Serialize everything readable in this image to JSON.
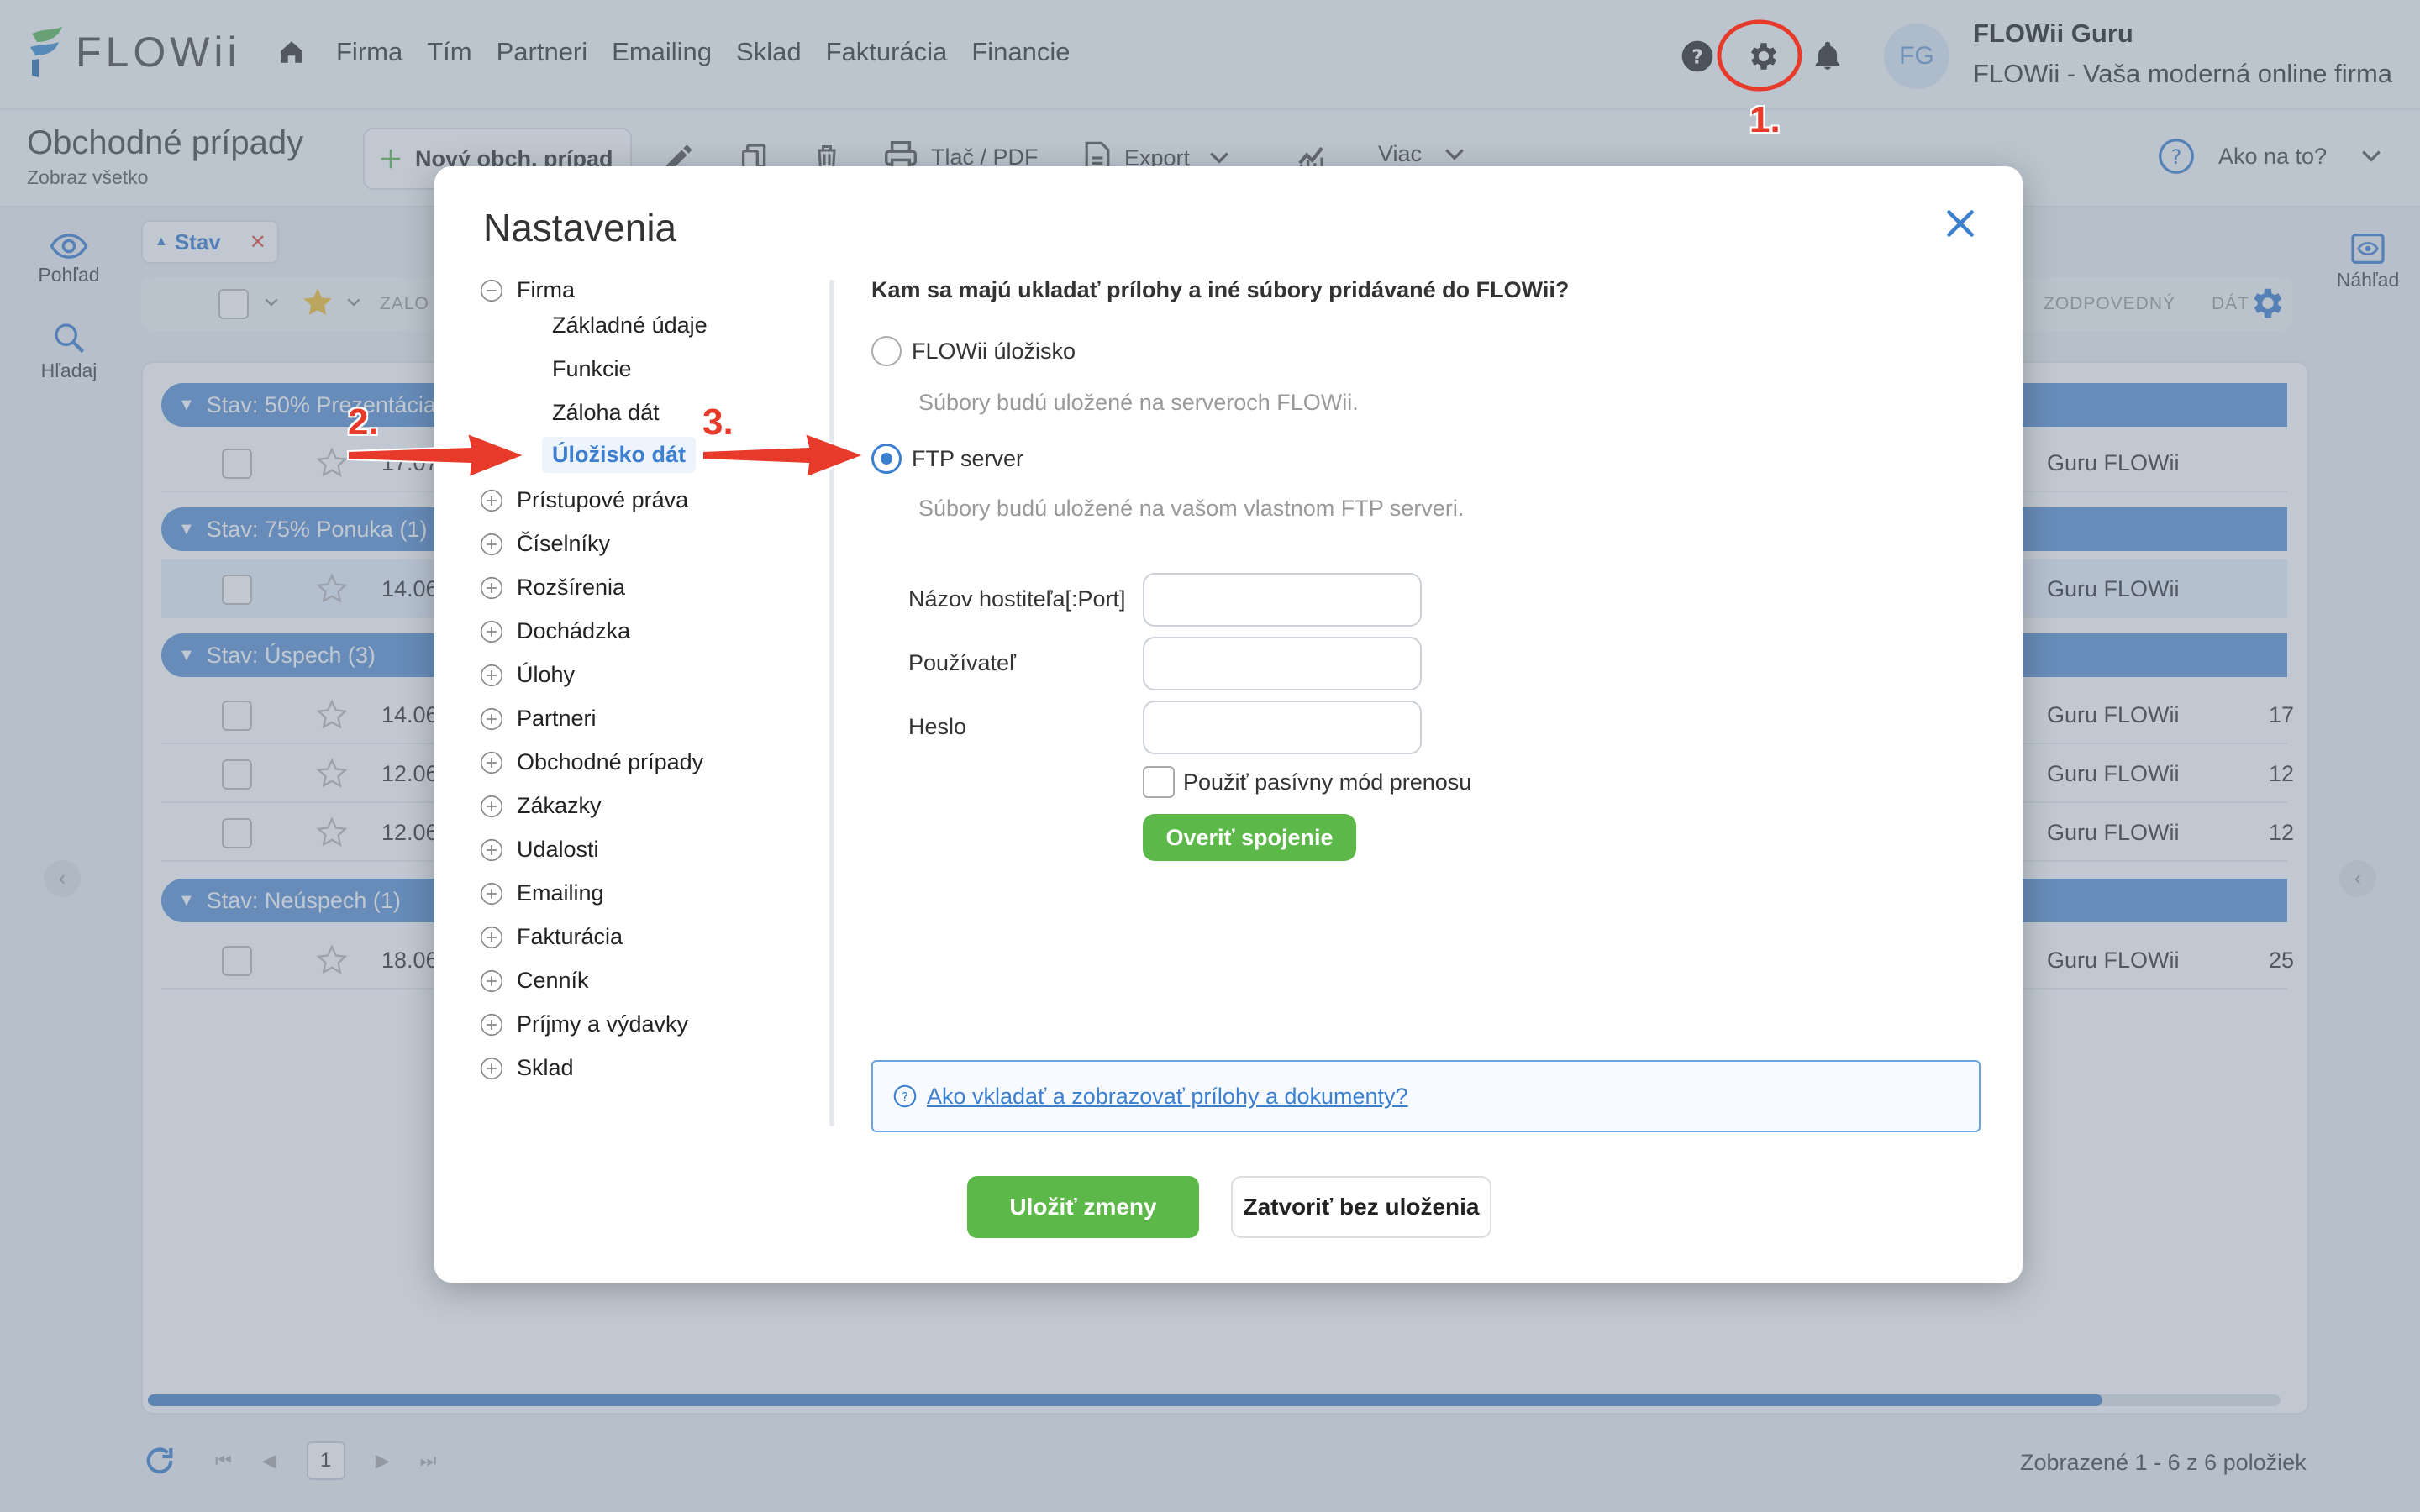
{
  "app": {
    "logo_text": "FLOWii",
    "nav": [
      "Firma",
      "Tím",
      "Partneri",
      "Emailing",
      "Sklad",
      "Fakturácia",
      "Financie"
    ],
    "user_initials": "FG",
    "user_name": "FLOWii Guru",
    "user_company": "FLOWii - Vaša moderná online firma"
  },
  "toolbar": {
    "page_title": "Obchodné prípady",
    "page_sub": "Zobraz všetko",
    "new_label": "Nový obch. prípad",
    "print_label": "Tlač / PDF",
    "export_label": "Export",
    "more_label": "Viac",
    "help_label": "Ako na to?"
  },
  "side": {
    "view_label": "Pohľad",
    "search_label": "Hľadaj",
    "preview_label": "Náhľad"
  },
  "list": {
    "filter_chip": "Stav",
    "col_created": "ZALO",
    "col_responsible": "ZODPOVEDNÝ",
    "col_date": "DÁT",
    "groups": [
      {
        "label": "Stav: 50% Prezentácia"
      },
      {
        "label": "Stav: 75% Ponuka (1)"
      },
      {
        "label": "Stav: Úspech (3)"
      },
      {
        "label": "Stav: Neúspech (1)"
      }
    ],
    "rows": [
      {
        "date": "17.07",
        "responsible": "Guru FLOWii",
        "extra": ""
      },
      {
        "date": "14.06",
        "responsible": "Guru FLOWii",
        "extra": ""
      },
      {
        "date": "14.06",
        "responsible": "Guru FLOWii",
        "extra": "17"
      },
      {
        "date": "12.06",
        "responsible": "Guru FLOWii",
        "extra": "12"
      },
      {
        "date": "12.06",
        "responsible": "Guru FLOWii",
        "extra": "12"
      },
      {
        "date": "18.06",
        "responsible": "Guru FLOWii",
        "extra": "25"
      }
    ],
    "page_current": "1",
    "footer_info": "Zobrazené 1 - 6 z 6 položiek"
  },
  "modal": {
    "title": "Nastavenia",
    "tree": {
      "firma": "Firma",
      "firma_children": [
        "Základné údaje",
        "Funkcie",
        "Záloha dát",
        "Úložisko dát"
      ],
      "others": [
        "Prístupové práva",
        "Číselníky",
        "Rozšírenia",
        "Dochádzka",
        "Úlohy",
        "Partneri",
        "Obchodné prípady",
        "Zákazky",
        "Udalosti",
        "Emailing",
        "Fakturácia",
        "Cenník",
        "Príjmy a výdavky",
        "Sklad"
      ]
    },
    "question": "Kam sa majú ukladať prílohy a iné súbory pridávané do FLOWii?",
    "opt1_label": "FLOWii úložisko",
    "opt1_desc": "Súbory budú uložené na serveroch FLOWii.",
    "opt2_label": "FTP server",
    "opt2_desc": "Súbory budú uložené na vašom vlastnom FTP serveri.",
    "host_label": "Názov hostiteľa[:Port]",
    "user_label": "Používateľ",
    "pass_label": "Heslo",
    "host_value": "",
    "user_value": "",
    "pass_value": "",
    "passive_label": "Použiť pasívny mód prenosu",
    "verify_label": "Overiť spojenie",
    "help_link": "Ako vkladať a zobrazovať prílohy a dokumenty?",
    "save_label": "Uložiť zmeny",
    "close_label": "Zatvoriť bez uloženia"
  },
  "annotations": {
    "n1": "1.",
    "n2": "2.",
    "n3": "3."
  },
  "colors": {
    "accent": "#3d7fcf",
    "green": "#5db84a",
    "annotation_red": "#e83a2b",
    "group_blue": "#5b92d3"
  }
}
